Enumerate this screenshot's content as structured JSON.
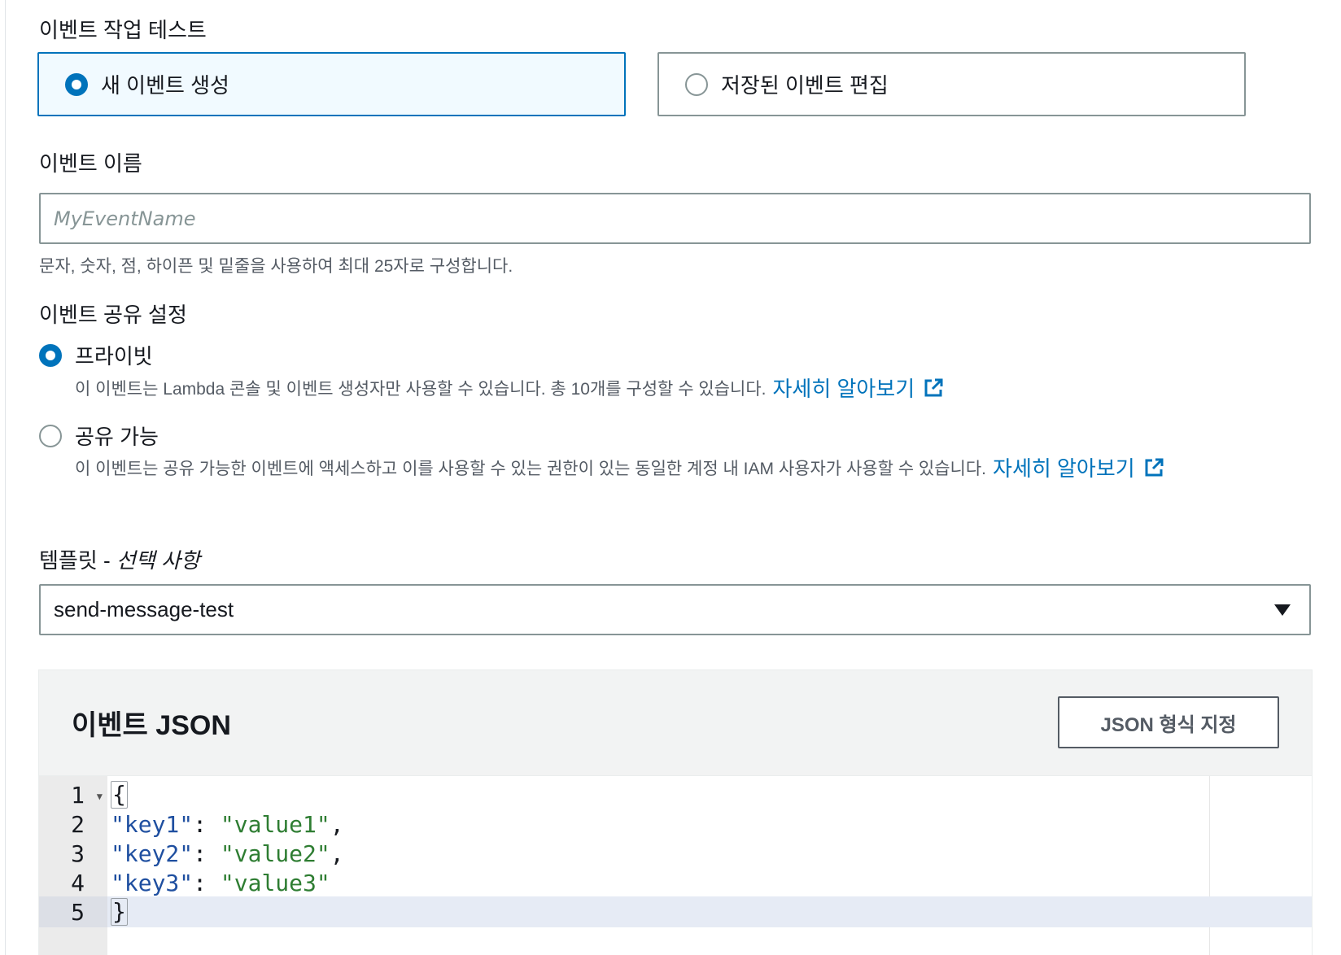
{
  "event_action": {
    "label": "이벤트 작업 테스트",
    "options": [
      {
        "label": "새 이벤트 생성",
        "selected": true
      },
      {
        "label": "저장된 이벤트 편집",
        "selected": false
      }
    ]
  },
  "event_name": {
    "label": "이벤트 이름",
    "placeholder": "MyEventName",
    "value": "",
    "hint": "문자, 숫자, 점, 하이픈 및 밑줄을 사용하여 최대 25자로 구성합니다."
  },
  "sharing": {
    "label": "이벤트 공유 설정",
    "options": [
      {
        "label": "프라이빗",
        "selected": true,
        "description": "이 이벤트는 Lambda 콘솔 및 이벤트 생성자만 사용할 수 있습니다. 총 10개를 구성할 수 있습니다.",
        "link": "자세히 알아보기"
      },
      {
        "label": "공유 가능",
        "selected": false,
        "description": "이 이벤트는 공유 가능한 이벤트에 액세스하고 이를 사용할 수 있는 권한이 있는 동일한 계정 내 IAM 사용자가 사용할 수 있습니다.",
        "link": "자세히 알아보기"
      }
    ]
  },
  "template": {
    "label": "템플릿 - ",
    "optional": "선택 사항",
    "selected": "send-message-test"
  },
  "event_json": {
    "title": "이벤트 JSON",
    "format_button": "JSON 형식 지정",
    "lines": [
      {
        "num": "1",
        "open": "{"
      },
      {
        "num": "2",
        "key": "\"key1\"",
        "colon": ": ",
        "value": "\"value1\"",
        "tail": ","
      },
      {
        "num": "3",
        "key": "\"key2\"",
        "colon": ": ",
        "value": "\"value2\"",
        "tail": ","
      },
      {
        "num": "4",
        "key": "\"key3\"",
        "colon": ": ",
        "value": "\"value3\"",
        "tail": ""
      },
      {
        "num": "5",
        "close": "}"
      }
    ]
  },
  "colors": {
    "accent": "#0073bb",
    "selected_tile_bg": "#f1faff",
    "json_key": "#1f4fa0",
    "json_string": "#2e7d32"
  }
}
